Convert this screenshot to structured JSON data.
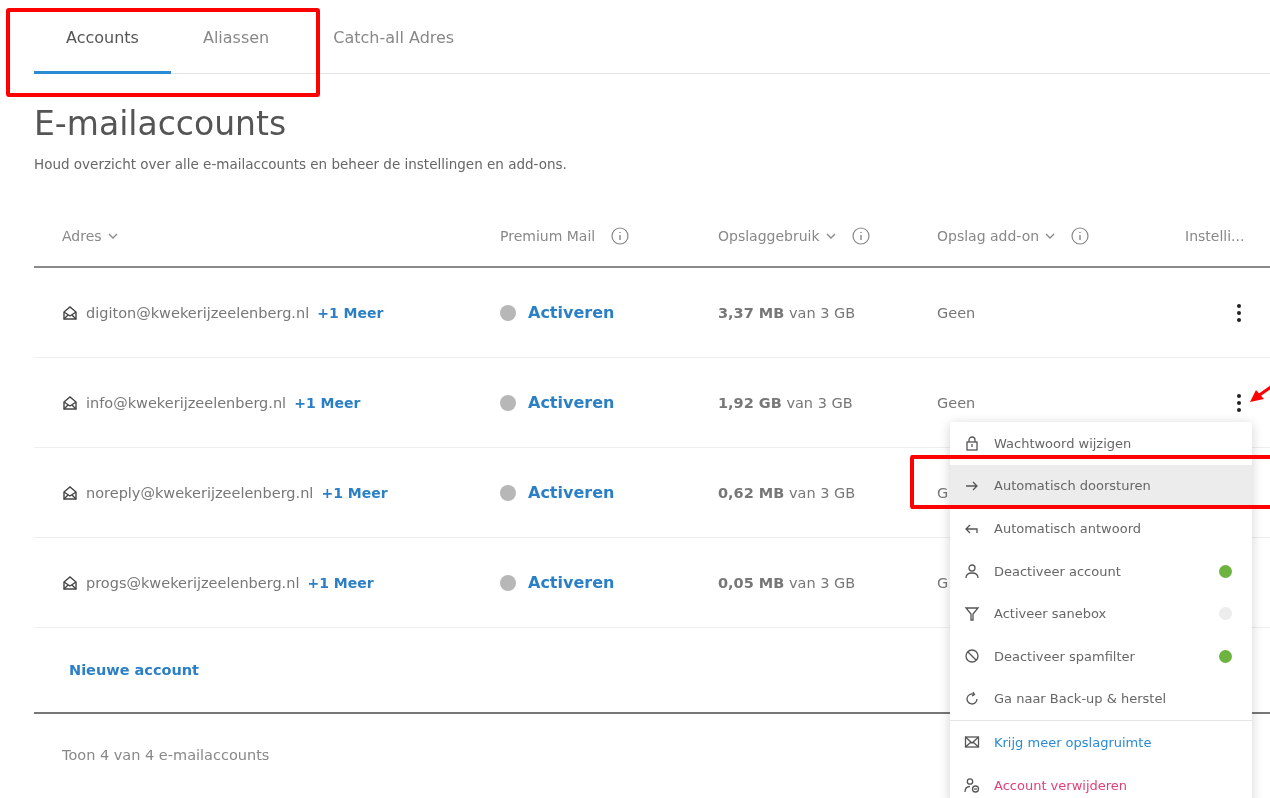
{
  "tabs": [
    {
      "label": "Accounts",
      "selected": true
    },
    {
      "label": "Aliassen",
      "selected": false
    },
    {
      "label": "Catch-all Adres",
      "selected": false
    }
  ],
  "title": "E-mailaccounts",
  "subtitle": "Houd overzicht over alle e-mailaccounts en beheer de instellingen en add-ons.",
  "table": {
    "columns": [
      {
        "label": "Adres",
        "kind": "sort"
      },
      {
        "label": "Premium Mail",
        "kind": "info"
      },
      {
        "label": "Opslaggebruik",
        "kind": "sortinfo"
      },
      {
        "label": "Opslag add-on",
        "kind": "sortinfo"
      },
      {
        "label": "Instelli...",
        "kind": "plain"
      }
    ],
    "rows": [
      {
        "address": "digiton@kwekerijzeelenberg.nl",
        "more": "+1 Meer",
        "premium": "Activeren",
        "storage": "**3,37 MB** van 3 GB",
        "addon": "Geen",
        "menu_open": false
      },
      {
        "address": "info@kwekerijzeelenberg.nl",
        "more": "+1 Meer",
        "premium": "Activeren",
        "storage": "**1,92 GB** van 3 GB",
        "addon": "Geen",
        "menu_open": true
      },
      {
        "address": "noreply@kwekerijzeelenberg.nl",
        "more": "+1 Meer",
        "premium": "Activeren",
        "storage": "**0,62 MB** van 3 GB",
        "addon": "G",
        "menu_open": false
      },
      {
        "address": "progs@kwekerijzeelenberg.nl",
        "more": "+1 Meer",
        "premium": "Activeren",
        "storage": "**0,05 MB** van 3 GB",
        "addon": "G",
        "menu_open": false
      }
    ]
  },
  "new_account": "Nieuwe account",
  "footer": "Toon 4 van 4 e-mailaccounts",
  "menu": {
    "items": [
      {
        "label": "Wachtwoord wijzigen",
        "kind": "normal",
        "selected": false
      },
      {
        "label": "Automatisch doorsturen",
        "kind": "normal",
        "selected": true
      },
      {
        "label": "Automatisch antwoord",
        "kind": "normal",
        "selected": false
      },
      {
        "label": "Deactiveer account",
        "kind": "toggle",
        "on": true,
        "selected": false
      },
      {
        "label": "Activeer sanebox",
        "kind": "toggle",
        "on": false,
        "selected": false
      },
      {
        "label": "Deactiveer spamfilter",
        "kind": "toggle",
        "on": true,
        "selected": false
      },
      {
        "label": "Ga naar Back-up & herstel",
        "kind": "normal",
        "selected": false
      },
      {
        "label": "Krijg meer opslagruimte",
        "kind": "link",
        "selected": false
      },
      {
        "label": "Account verwijderen",
        "kind": "danger",
        "selected": false
      }
    ]
  }
}
